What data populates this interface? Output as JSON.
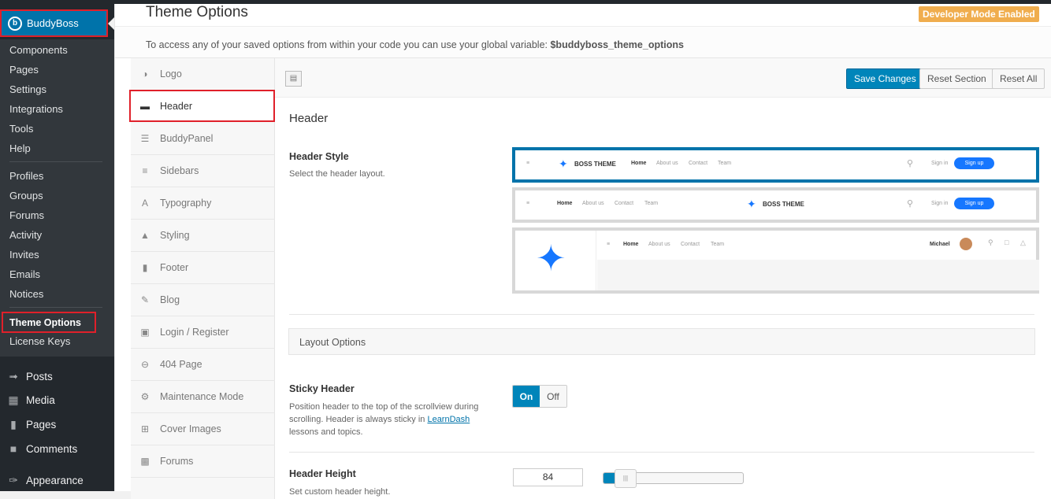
{
  "wp": {
    "brand": "BuddyBoss",
    "submenu": [
      "Components",
      "Pages",
      "Settings",
      "Integrations",
      "Tools",
      "Help",
      "Profiles",
      "Groups",
      "Forums",
      "Activity",
      "Invites",
      "Emails",
      "Notices",
      "Theme Options",
      "License Keys"
    ],
    "menu": [
      "Posts",
      "Media",
      "Pages",
      "Comments",
      "Appearance"
    ]
  },
  "page": {
    "title": "Theme Options",
    "dev_badge": "Developer Mode Enabled",
    "intro_text": "To access any of your saved options from within your code you can use your global variable: ",
    "intro_var": "$buddyboss_theme_options"
  },
  "sections": [
    "Logo",
    "Header",
    "BuddyPanel",
    "Sidebars",
    "Typography",
    "Styling",
    "Footer",
    "Blog",
    "Login / Register",
    "404 Page",
    "Maintenance Mode",
    "Cover Images",
    "Forums"
  ],
  "toolbar": {
    "save": "Save Changes",
    "reset_section": "Reset Section",
    "reset_all": "Reset All"
  },
  "header": {
    "section_title": "Header",
    "style_label": "Header Style",
    "style_desc": "Select the header layout.",
    "previews": {
      "brand": "BOSS THEME",
      "nav": [
        "Home",
        "About us",
        "Contact",
        "Team"
      ],
      "sign_in": "Sign in",
      "sign_up": "Sign up",
      "user": "Michael"
    },
    "layout_options": "Layout Options",
    "sticky_label": "Sticky Header",
    "sticky_desc_1": "Position header to the top of the scrollview during scrolling. Header is always sticky in ",
    "sticky_link": "LearnDash",
    "sticky_desc_2": " lessons and topics.",
    "toggle_on": "On",
    "toggle_off": "Off",
    "height_label": "Header Height",
    "height_desc": "Set custom header height.",
    "height_value": "84",
    "height_fraction": 0.16
  },
  "colors": {
    "accent": "#0073aa",
    "highlight": "#e0202a",
    "badge": "#f0ad4e"
  }
}
